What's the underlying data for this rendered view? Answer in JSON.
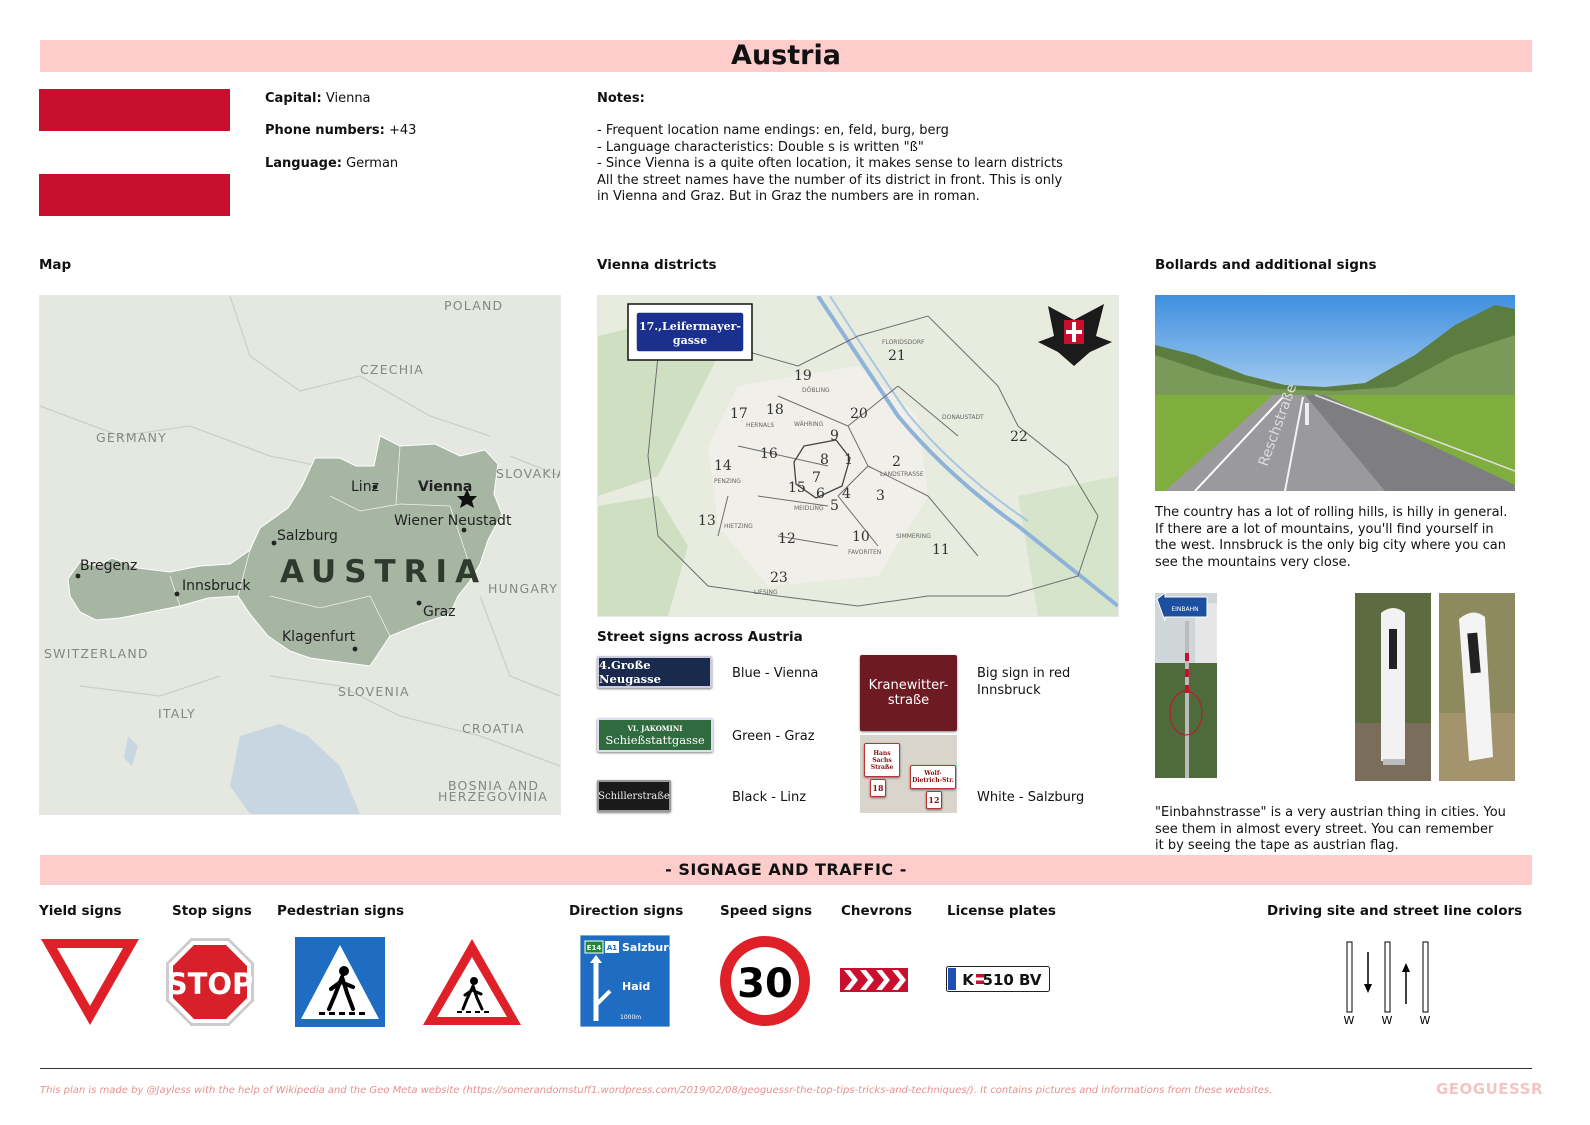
{
  "title": "Austria",
  "info": {
    "capital_label": "Capital:",
    "capital": "Vienna",
    "phone_label": "Phone numbers:",
    "phone": "+43",
    "language_label": "Language:",
    "language": "German"
  },
  "notes": {
    "label": "Notes:",
    "lines": [
      "- Frequent location name endings: en, feld, burg, berg",
      "- Language characteristics: Double s is written \"ß\"",
      "- Since Vienna is a quite often location, it makes sense to learn districts",
      "All the street names have the number of its district in front. This is only",
      "in Vienna and Graz. But in Graz the numbers are in roman."
    ]
  },
  "colors": {
    "band": "#ffcccc",
    "flag_red": "#c8102e",
    "map_country": "#a7b5a3",
    "map_land": "#e4e8e1",
    "map_water": "#c7d6e0"
  },
  "map": {
    "heading": "Map",
    "country_label": "AUSTRIA",
    "neighbors": [
      "POLAND",
      "CZECHIA",
      "GERMANY",
      "SLOVAKIA",
      "HUNGARY",
      "SWITZERLAND",
      "SLOVENIA",
      "ITALY",
      "CROATIA",
      "BOSNIA AND",
      "HERZEGOVINIA"
    ],
    "cities": [
      "Linz",
      "Vienna",
      "Salzburg",
      "Wiener Neustadt",
      "Bregenz",
      "Innsbruck",
      "Graz",
      "Klagenfurt"
    ]
  },
  "vienna": {
    "heading": "Vienna districts",
    "sign_text_1": "17.,Leifermayer-",
    "sign_text_2": "gasse",
    "districts": [
      "21",
      "19",
      "17",
      "18",
      "20",
      "22",
      "9",
      "16",
      "8",
      "1",
      "2",
      "14",
      "7",
      "15",
      "6",
      "4",
      "3",
      "13",
      "5",
      "12",
      "10",
      "11",
      "23"
    ],
    "places": [
      "FLORIDSDORF",
      "DÖBLING",
      "DONAUSTADT",
      "HERNALS",
      "WÄHRING",
      "LANDSTRASSE",
      "PENZING",
      "HIETZING",
      "MEIDLING",
      "FAVORITEN",
      "SIMMERING",
      "LIESING"
    ]
  },
  "street_signs": {
    "heading": "Street signs across Austria",
    "items": [
      {
        "sign_text": "4.Große Neugasse",
        "label": "Blue - Vienna"
      },
      {
        "sign_text_top": "VI. JAKOMINI",
        "sign_text": "Schießstattgasse",
        "label": "Green - Graz"
      },
      {
        "sign_text": "Schillerstraße",
        "label": "Black - Linz"
      },
      {
        "sign_text": "Kranewitter-straße",
        "label_1": "Big sign in red",
        "label_2": "Innsbruck"
      },
      {
        "sign_text_1": "Hans Sachs Straße",
        "sign_text_2": "Wolf-Dietrich-Str.",
        "num_1": "18",
        "num_2": "12",
        "label": "White - Salzburg"
      }
    ]
  },
  "bollards": {
    "heading": "Bollards and additional signs",
    "photo_text": "Reschstraße",
    "paragraph": [
      "The country has a lot of rolling hills, is hilly in general.",
      "If there are a lot of mountains, you'll find yourself in",
      "the west. Innsbruck is the only big city where you can",
      "see the mountains very close."
    ],
    "einbahn_sign": "EINBAHN",
    "paragraph2": [
      "\"Einbahnstrasse\" is a very austrian thing in cities. You",
      "see them in almost every street. You can remember",
      "it by seeing the tape as austrian flag."
    ]
  },
  "signage": {
    "banner": "- SIGNAGE AND TRAFFIC -",
    "yield_label": "Yield signs",
    "stop_label": "Stop signs",
    "stop_text": "STOP",
    "pedestrian_label": "Pedestrian signs",
    "direction_label": "Direction signs",
    "direction_e14": "E14",
    "direction_a1": "A1",
    "direction_top": "Salzburg",
    "direction_bottom": "Haid",
    "direction_dist": "1000m",
    "speed_label": "Speed signs",
    "speed_value": "30",
    "chevrons_label": "Chevrons",
    "plates_label": "License plates",
    "plate_text_k": "K",
    "plate_text": "510 BV",
    "driving_label": "Driving site and street line colors",
    "line_labels": [
      "W",
      "W",
      "W"
    ]
  },
  "footer": {
    "text": "This plan is made by @Jayless with the help of Wikipedia and the Geo Meta website (https://somerandomstuff1.wordpress.com/2019/02/08/geoguessr-the-top-tips-tricks-and-techniques/). It contains pictures and informations from these websites.",
    "logo": "GEOGUESSR"
  }
}
